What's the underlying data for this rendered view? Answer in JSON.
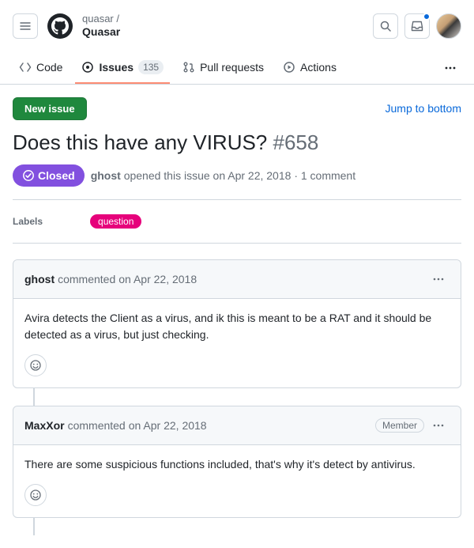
{
  "header": {
    "owner": "quasar /",
    "repo": "Quasar"
  },
  "tabs": {
    "code": "Code",
    "issues": "Issues",
    "issues_count": "135",
    "pulls": "Pull requests",
    "actions": "Actions"
  },
  "actions": {
    "new_issue": "New issue",
    "jump_bottom": "Jump to bottom"
  },
  "issue": {
    "title": "Does this have any VIRUS?",
    "number": "#658",
    "state": "Closed",
    "author": "ghost",
    "opened_text": "opened this issue",
    "opened_date": "on Apr 22, 2018",
    "comment_count": "· 1 comment"
  },
  "labels": {
    "label": "Labels",
    "items": [
      "question"
    ]
  },
  "comments": [
    {
      "author": "ghost",
      "verb": "commented",
      "date": "on Apr 22, 2018",
      "role": "",
      "body": "Avira detects the Client as a virus, and ik this is meant to be a RAT and it should be detected as a virus, but just checking."
    },
    {
      "author": "MaxXor",
      "verb": "commented",
      "date": "on Apr 22, 2018",
      "role": "Member",
      "body": "There are some suspicious functions included, that's why it's detect by antivirus."
    }
  ]
}
